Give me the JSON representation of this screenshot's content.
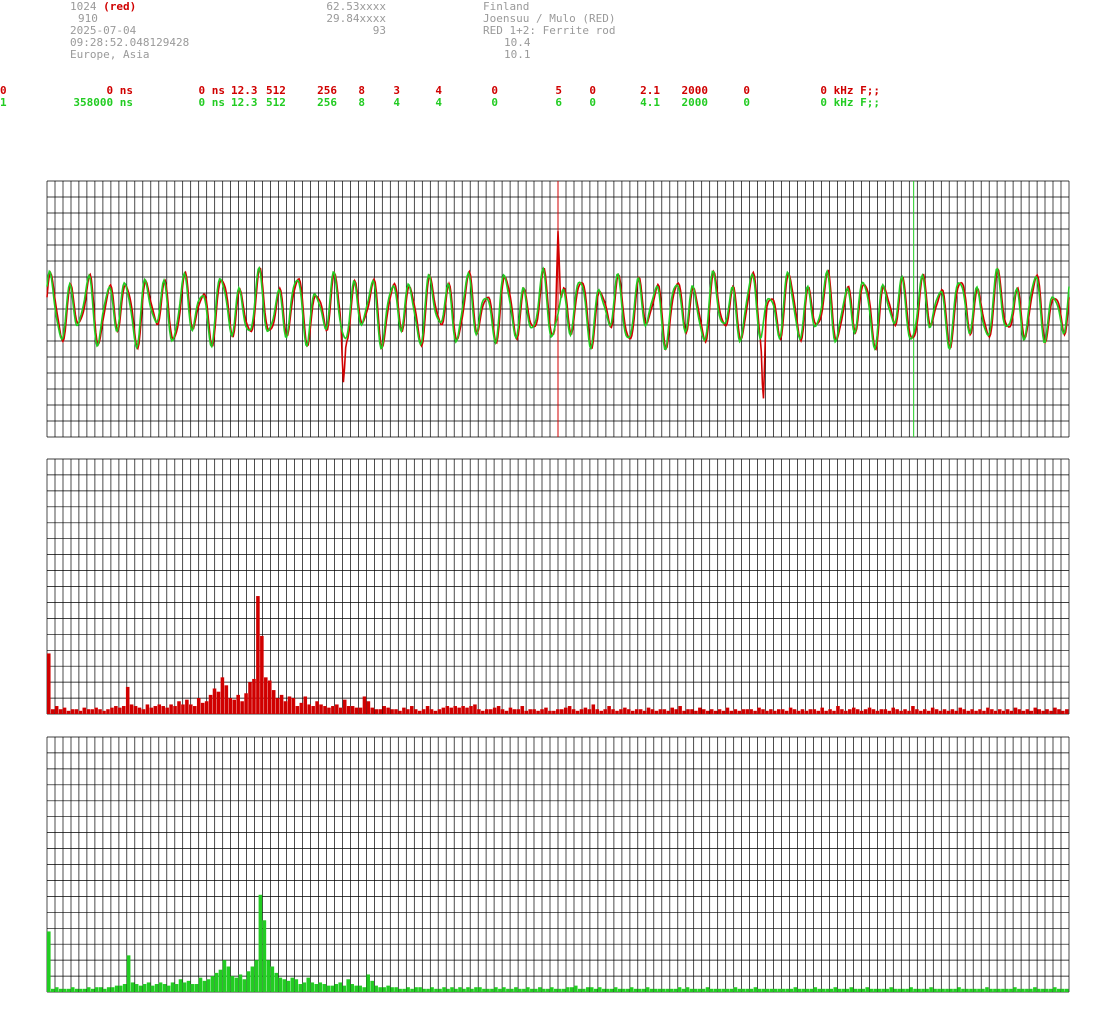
{
  "header": {
    "col1": [
      "1024",
      "910",
      "2025-07-04",
      "09:28:52.048129428",
      "Europe, Asia"
    ],
    "col1_tag": "(red)",
    "col2": [
      "62.53xxxx",
      "29.84xxxx",
      "93"
    ],
    "col3": [
      "Finland",
      "Joensuu / Mulo (RED)",
      "RED 1+2: Ferrite rod",
      "10.4",
      "10.1"
    ]
  },
  "channels": [
    {
      "ch": "0",
      "delay": "0 ns",
      "offset": "0 ns",
      "f1": "12.3",
      "f2": "512",
      "f3": "256",
      "f4": "8",
      "f5": "3",
      "f6": "4",
      "f7": "0",
      "f8": "5",
      "f9": "0",
      "f10": "2.1",
      "f11": "2000",
      "f12": "0",
      "f13": "0 kHz F;;",
      "color": "#d00000"
    },
    {
      "ch": "1",
      "delay": "358000 ns",
      "offset": "0 ns",
      "f1": "12.3",
      "f2": "512",
      "f3": "256",
      "f4": "8",
      "f5": "4",
      "f6": "4",
      "f7": "0",
      "f8": "6",
      "f9": "0",
      "f10": "4.1",
      "f11": "2000",
      "f12": "0",
      "f13": "0 kHz F;;",
      "color": "#22cc22"
    }
  ],
  "chart_data": [
    {
      "type": "line",
      "grid": true,
      "ylim": [
        -8,
        8
      ],
      "markers": [
        {
          "series": 0,
          "x": 0.5
        },
        {
          "series": 1,
          "x": 0.848
        }
      ],
      "series": [
        {
          "color": "#d00000",
          "spikes": [
            {
              "x": 0.5,
              "y": 5.6
            },
            {
              "x": 0.29,
              "y": -3.2
            },
            {
              "x": 0.701,
              "y": -4.4
            }
          ]
        },
        {
          "color": "#22cc22",
          "spikes": []
        }
      ]
    },
    {
      "type": "bar",
      "grid": true,
      "ylim": [
        0,
        16
      ],
      "color": "#d00000",
      "values": [
        3.8,
        0.3,
        0.5,
        0.3,
        0.4,
        0.2,
        0.3,
        0.3,
        0.2,
        0.4,
        0.3,
        0.3,
        0.4,
        0.3,
        0.2,
        0.3,
        0.4,
        0.5,
        0.4,
        0.5,
        1.7,
        0.6,
        0.5,
        0.4,
        0.3,
        0.6,
        0.4,
        0.5,
        0.6,
        0.5,
        0.4,
        0.6,
        0.5,
        0.8,
        0.6,
        0.9,
        0.6,
        0.5,
        1.0,
        0.7,
        0.8,
        1.2,
        1.6,
        1.4,
        2.3,
        1.8,
        1.0,
        0.9,
        1.2,
        0.8,
        1.3,
        2.0,
        2.2,
        7.4,
        4.9,
        2.3,
        2.1,
        1.5,
        1.0,
        1.2,
        0.8,
        1.1,
        1.0,
        0.5,
        0.7,
        1.1,
        0.6,
        0.5,
        0.8,
        0.6,
        0.5,
        0.4,
        0.5,
        0.6,
        0.4,
        0.9,
        0.5,
        0.5,
        0.4,
        0.4,
        1.1,
        0.8,
        0.4,
        0.3,
        0.3,
        0.5,
        0.4,
        0.3,
        0.3,
        0.2,
        0.4,
        0.3,
        0.5,
        0.3,
        0.2,
        0.3,
        0.5,
        0.3,
        0.2,
        0.3,
        0.4,
        0.5,
        0.4,
        0.5,
        0.4,
        0.5,
        0.4,
        0.5,
        0.6,
        0.3,
        0.2,
        0.3,
        0.3,
        0.4,
        0.5,
        0.3,
        0.2,
        0.4,
        0.3,
        0.3,
        0.5,
        0.2,
        0.3,
        0.3,
        0.2,
        0.3,
        0.4,
        0.2,
        0.2,
        0.3,
        0.3,
        0.4,
        0.5,
        0.3,
        0.2,
        0.3,
        0.4,
        0.3,
        0.6,
        0.3,
        0.2,
        0.3,
        0.5,
        0.3,
        0.2,
        0.3,
        0.4,
        0.3,
        0.2,
        0.3,
        0.3,
        0.2,
        0.4,
        0.3,
        0.2,
        0.3,
        0.3,
        0.2,
        0.4,
        0.3,
        0.5,
        0.2,
        0.3,
        0.3,
        0.2,
        0.4,
        0.3,
        0.2,
        0.3,
        0.2,
        0.3,
        0.2,
        0.4,
        0.2,
        0.3,
        0.2,
        0.3,
        0.3,
        0.3,
        0.2,
        0.4,
        0.3,
        0.2,
        0.3,
        0.2,
        0.3,
        0.3,
        0.2,
        0.4,
        0.3,
        0.2,
        0.3,
        0.2,
        0.3,
        0.3,
        0.2,
        0.4,
        0.2,
        0.3,
        0.2,
        0.5,
        0.3,
        0.2,
        0.3,
        0.4,
        0.3,
        0.2,
        0.3,
        0.4,
        0.3,
        0.2,
        0.3,
        0.3,
        0.2,
        0.4,
        0.3,
        0.2,
        0.3,
        0.2,
        0.5,
        0.3,
        0.2,
        0.3,
        0.2,
        0.4,
        0.3,
        0.2,
        0.3,
        0.2,
        0.3,
        0.2,
        0.4,
        0.3,
        0.2,
        0.3,
        0.2,
        0.3,
        0.2,
        0.4,
        0.3,
        0.2,
        0.3,
        0.2,
        0.3,
        0.2,
        0.4,
        0.3,
        0.2,
        0.3,
        0.2,
        0.4,
        0.3,
        0.2,
        0.3,
        0.2,
        0.4,
        0.3,
        0.2,
        0.3
      ]
    },
    {
      "type": "bar",
      "grid": true,
      "ylim": [
        0,
        16
      ],
      "color": "#22cc22",
      "values": [
        3.8,
        0.2,
        0.3,
        0.2,
        0.2,
        0.2,
        0.3,
        0.2,
        0.2,
        0.2,
        0.3,
        0.2,
        0.3,
        0.3,
        0.2,
        0.3,
        0.3,
        0.4,
        0.4,
        0.5,
        2.3,
        0.6,
        0.5,
        0.4,
        0.5,
        0.6,
        0.4,
        0.5,
        0.6,
        0.5,
        0.4,
        0.6,
        0.5,
        0.8,
        0.6,
        0.7,
        0.5,
        0.5,
        0.9,
        0.7,
        0.8,
        1.0,
        1.2,
        1.4,
        2.0,
        1.6,
        1.0,
        0.9,
        1.1,
        0.8,
        1.3,
        1.6,
        2.0,
        6.1,
        4.5,
        2.0,
        1.6,
        1.2,
        0.9,
        0.8,
        0.7,
        0.9,
        0.8,
        0.5,
        0.6,
        0.9,
        0.6,
        0.5,
        0.6,
        0.5,
        0.4,
        0.4,
        0.5,
        0.6,
        0.4,
        0.8,
        0.5,
        0.4,
        0.4,
        0.3,
        1.1,
        0.7,
        0.4,
        0.3,
        0.3,
        0.4,
        0.3,
        0.3,
        0.2,
        0.2,
        0.3,
        0.2,
        0.3,
        0.3,
        0.2,
        0.2,
        0.3,
        0.2,
        0.2,
        0.3,
        0.2,
        0.3,
        0.2,
        0.3,
        0.2,
        0.3,
        0.2,
        0.3,
        0.3,
        0.2,
        0.2,
        0.2,
        0.3,
        0.2,
        0.3,
        0.2,
        0.2,
        0.3,
        0.2,
        0.2,
        0.3,
        0.2,
        0.2,
        0.3,
        0.2,
        0.2,
        0.3,
        0.2,
        0.2,
        0.2,
        0.3,
        0.3,
        0.4,
        0.2,
        0.2,
        0.3,
        0.3,
        0.2,
        0.3,
        0.2,
        0.2,
        0.2,
        0.3,
        0.2,
        0.2,
        0.2,
        0.3,
        0.2,
        0.2,
        0.2,
        0.3,
        0.2,
        0.2,
        0.2,
        0.2,
        0.2,
        0.2,
        0.2,
        0.3,
        0.2,
        0.3,
        0.2,
        0.2,
        0.2,
        0.2,
        0.3,
        0.2,
        0.2,
        0.2,
        0.2,
        0.2,
        0.2,
        0.3,
        0.2,
        0.2,
        0.2,
        0.2,
        0.3,
        0.2,
        0.2,
        0.2,
        0.2,
        0.2,
        0.2,
        0.2,
        0.2,
        0.2,
        0.3,
        0.2,
        0.2,
        0.2,
        0.2,
        0.3,
        0.2,
        0.2,
        0.2,
        0.2,
        0.3,
        0.2,
        0.2,
        0.2,
        0.3,
        0.2,
        0.2,
        0.2,
        0.3,
        0.2,
        0.2,
        0.2,
        0.2,
        0.2,
        0.3,
        0.2,
        0.2,
        0.2,
        0.2,
        0.3,
        0.2,
        0.2,
        0.2,
        0.2,
        0.3,
        0.2,
        0.2,
        0.2,
        0.2,
        0.2,
        0.2,
        0.3,
        0.2,
        0.2,
        0.2,
        0.2,
        0.2,
        0.2,
        0.3,
        0.2,
        0.2,
        0.2,
        0.2,
        0.2,
        0.2,
        0.3,
        0.2,
        0.2,
        0.2,
        0.2,
        0.3,
        0.2,
        0.2,
        0.2,
        0.2,
        0.3,
        0.2,
        0.2,
        0.2
      ]
    }
  ]
}
